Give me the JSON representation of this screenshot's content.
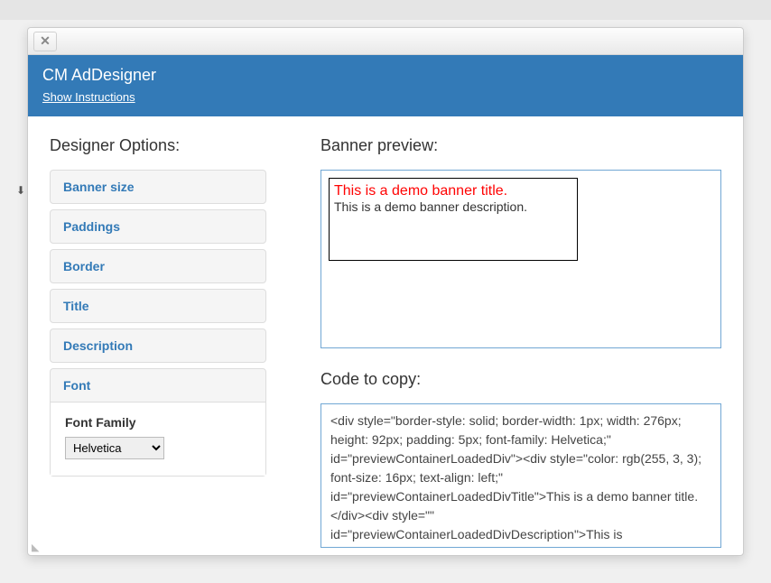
{
  "app": {
    "title": "CM AdDesigner",
    "show_instructions": "Show Instructions"
  },
  "left": {
    "heading": "Designer Options:"
  },
  "accordion": [
    {
      "label": "Banner size"
    },
    {
      "label": "Paddings"
    },
    {
      "label": "Border"
    },
    {
      "label": "Title"
    },
    {
      "label": "Description"
    },
    {
      "label": "Font"
    }
  ],
  "font_panel": {
    "field_label": "Font Family",
    "selected": "Helvetica"
  },
  "right": {
    "preview_heading": "Banner preview:",
    "code_heading": "Code to copy:"
  },
  "banner": {
    "title": "This is a demo banner title.",
    "description": "This is a demo banner description."
  },
  "code_text": "<div style=\"border-style: solid; border-width: 1px; width: 276px; height: 92px; padding: 5px; font-family: Helvetica;\" id=\"previewContainerLoadedDiv\"><div style=\"color: rgb(255, 3, 3); font-size: 16px; text-align: left;\" id=\"previewContainerLoadedDivTitle\">This is a demo banner title.</div><div style=\"\" id=\"previewContainerLoadedDivDescription\">This is"
}
